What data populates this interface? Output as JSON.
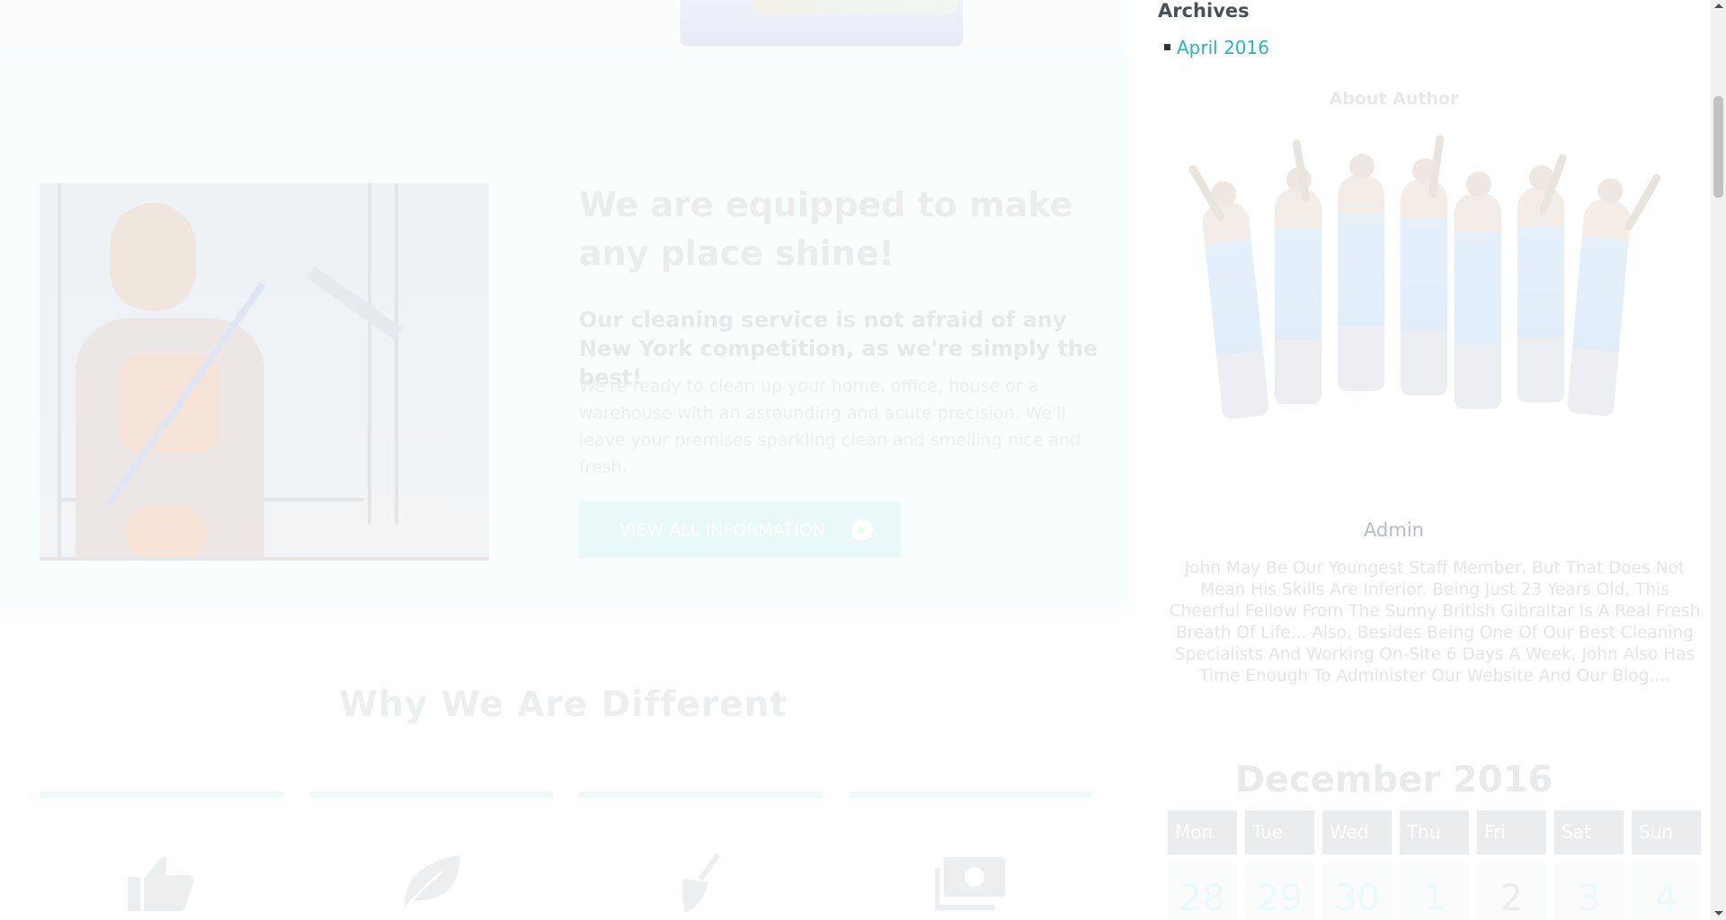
{
  "feature": {
    "title": "We are equipped to make any place shine!",
    "subtitle": "Our cleaning service is not afraid of any New York competition, as we're simply the best!",
    "body": "We're ready to clean up your home, office, house or a warehouse with an astounding and acute precision. We'll leave your premises sparkling clean and smelling nice and fresh.",
    "button_label": "VIEW ALL INFORMATION",
    "button_icon": "arrow-circle-right-icon"
  },
  "different": {
    "title": "Why We Are Different",
    "cards": [
      {
        "icon": "thumbs-up-icon"
      },
      {
        "icon": "leaf-icon"
      },
      {
        "icon": "broom-icon"
      },
      {
        "icon": "money-icon"
      }
    ]
  },
  "sidebar": {
    "archives": {
      "title": "Archives",
      "items": [
        "April 2016"
      ]
    },
    "about": {
      "title": "About Author",
      "name": "Admin",
      "bio": "John May Be Our Youngest Staff Member, But That Does Not Mean His Skills Are Inferior. Being Just 23 Years Old, This Cheerful Fellow From The Sunny British Gibraltar Is A Real Fresh Breath Of Life... Also, Besides Being One Of Our Best Cleaning Specialists And Working On-Site 6 Days A Week, John Also Has Time Enough To Administer Our Website And Our Blog...."
    },
    "calendar": {
      "title": "December 2016",
      "weekdays": [
        "Mon",
        "Tue",
        "Wed",
        "Thu",
        "Fri",
        "Sat",
        "Sun"
      ],
      "first_row": [
        "28",
        "29",
        "30",
        "1",
        "2",
        "3",
        "4"
      ]
    }
  },
  "colors": {
    "accent": "#1fb8c3",
    "button_bg": "#e9f9f9",
    "heading_faded": "#eaecee"
  }
}
